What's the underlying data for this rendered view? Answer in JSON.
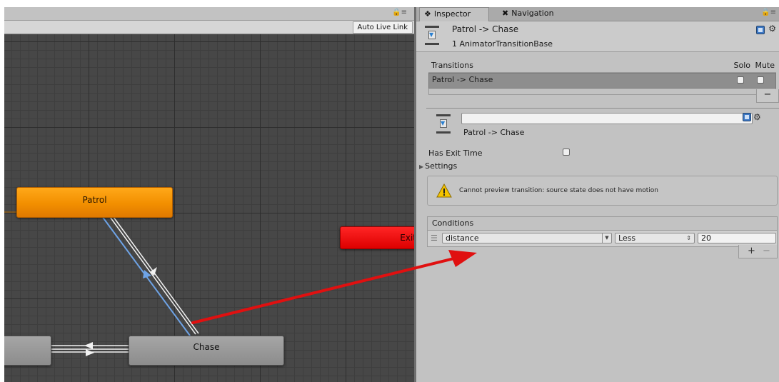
{
  "animator": {
    "auto_live_link": "Auto Live Link",
    "states": {
      "patrol": "Patrol",
      "exit": "Exit",
      "chase": "Chase"
    }
  },
  "inspector": {
    "tabs": {
      "inspector": "Inspector",
      "navigation": "Navigation"
    },
    "header": {
      "title": "Patrol -> Chase",
      "subtitle": "1 AnimatorTransitionBase"
    },
    "transitions": {
      "label": "Transitions",
      "solo_label": "Solo",
      "mute_label": "Mute",
      "items": [
        {
          "name": "Patrol -> Chase",
          "solo": false,
          "mute": false
        }
      ],
      "remove_label": "−"
    },
    "detail": {
      "name_value": "",
      "label": "Patrol -> Chase"
    },
    "has_exit_time": {
      "label": "Has Exit Time",
      "checked": false
    },
    "settings_label": "Settings",
    "warning": "Cannot preview transition: source state does not have motion",
    "conditions": {
      "label": "Conditions",
      "items": [
        {
          "parameter": "distance",
          "operator": "Less",
          "value": "20"
        }
      ],
      "add_label": "+",
      "remove_label": "−"
    }
  },
  "colors": {
    "patrol_state": "#f29200",
    "exit_state": "#e00000",
    "default_state": "#9a9a9a",
    "selected_transition": "#6ea3e6",
    "annotation_arrow": "#e01010"
  }
}
